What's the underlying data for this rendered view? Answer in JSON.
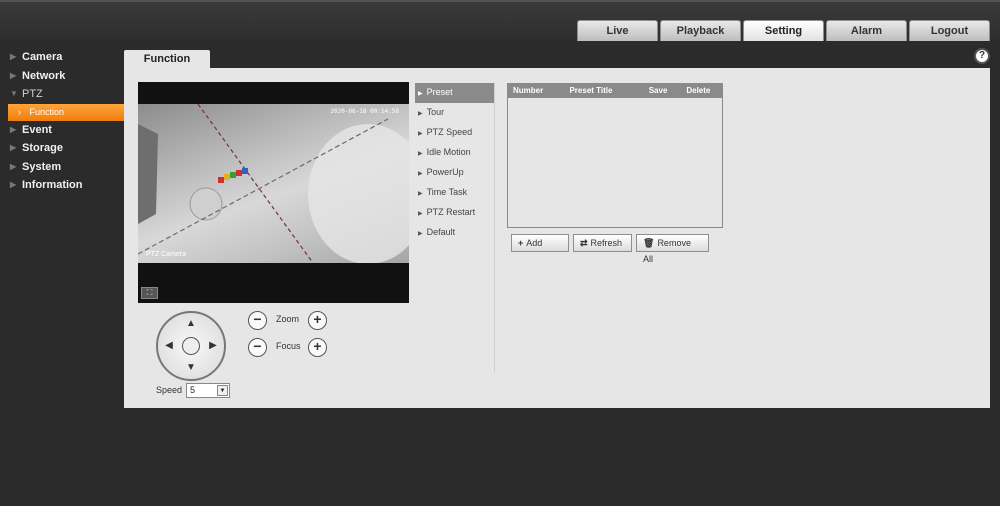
{
  "top_tabs": [
    {
      "label": "Live",
      "active": false
    },
    {
      "label": "Playback",
      "active": false
    },
    {
      "label": "Setting",
      "active": true
    },
    {
      "label": "Alarm",
      "active": false
    },
    {
      "label": "Logout",
      "active": false
    }
  ],
  "nav": {
    "camera": "Camera",
    "network": "Network",
    "ptz": "PTZ",
    "function": "Function",
    "event": "Event",
    "storage": "Storage",
    "system": "System",
    "information": "Information"
  },
  "content": {
    "tab_label": "Function",
    "help_icon": "?"
  },
  "video": {
    "timestamp": "2020-06-18 00:14:58",
    "channel_name": "PTZ Camera"
  },
  "ptz": {
    "zoom_label": "Zoom",
    "focus_label": "Focus",
    "speed_label": "Speed",
    "speed_value": "5"
  },
  "submenu": [
    {
      "label": "Preset",
      "active": true
    },
    {
      "label": "Tour",
      "active": false
    },
    {
      "label": "PTZ Speed",
      "active": false
    },
    {
      "label": "Idle Motion",
      "active": false
    },
    {
      "label": "PowerUp",
      "active": false
    },
    {
      "label": "Time Task",
      "active": false
    },
    {
      "label": "PTZ Restart",
      "active": false
    },
    {
      "label": "Default",
      "active": false
    }
  ],
  "preset_table": {
    "columns": [
      "Number",
      "Preset Title",
      "Save",
      "Delete"
    ],
    "rows": []
  },
  "buttons": {
    "add": "Add",
    "refresh": "Refresh",
    "remove_all": "Remove All"
  }
}
